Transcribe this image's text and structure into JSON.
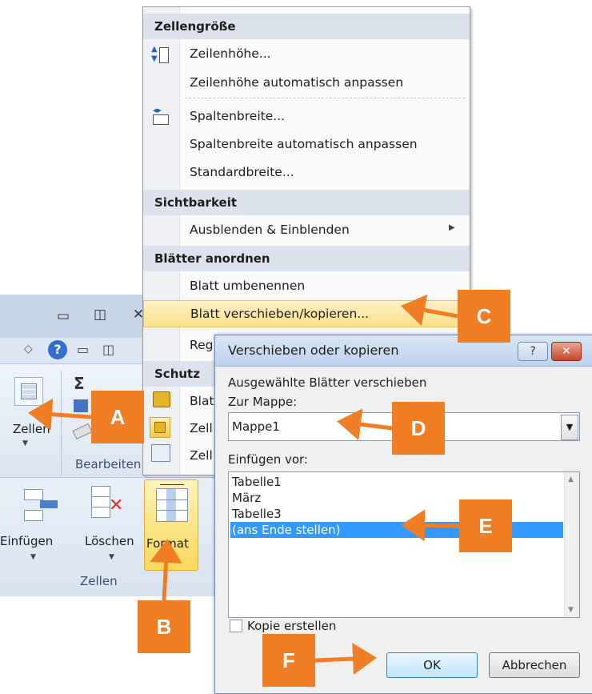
{
  "menu": {
    "sections": {
      "cell_size": "Zellengröße",
      "visibility": "Sichtbarkeit",
      "arrange_sheets": "Blätter anordnen",
      "protection": "Schutz"
    },
    "items": {
      "row_height": "Zeilenhöhe...",
      "autofit_row_height": "Zeilenhöhe automatisch anpassen",
      "column_width": "Spaltenbreite...",
      "autofit_column_width": "Spaltenbreite automatisch anpassen",
      "default_width": "Standardbreite...",
      "hide_unhide": "Ausblenden & Einblenden",
      "rename_sheet": "Blatt umbenennen",
      "move_copy_sheet": "Blatt verschieben/kopieren...",
      "partial_reg": "Reg",
      "partial_blat": "Blat",
      "partial_zell_1": "Zell",
      "partial_zell_2": "Zell"
    }
  },
  "ribbon": {
    "cells_label_top": "Zellen",
    "editing_label": "Bearbeiten",
    "insert": "Einfügen",
    "delete": "Löschen",
    "format": "Format",
    "cells_group": "Zellen",
    "sigma": "Σ"
  },
  "dialog": {
    "title": "Verschieben oder kopieren",
    "help_button": "?",
    "close_button": "✕",
    "description": "Ausgewählte Blätter verschieben",
    "to_book_label": "Zur Mappe:",
    "to_book_value": "Mappe1",
    "insert_before_label": "Einfügen vor:",
    "sheets": [
      "Tabelle1",
      "März",
      "Tabelle3",
      "(ans Ende stellen)"
    ],
    "selected_index": 3,
    "copy_checkbox_label": "Kopie erstellen",
    "ok": "OK",
    "cancel": "Abbrechen"
  },
  "callouts": {
    "a": "A",
    "b": "B",
    "c": "C",
    "d": "D",
    "e": "E",
    "f": "F"
  },
  "colors": {
    "callout": "#f07e25",
    "selection": "#3399ff",
    "highlight": "#fbe08a"
  }
}
